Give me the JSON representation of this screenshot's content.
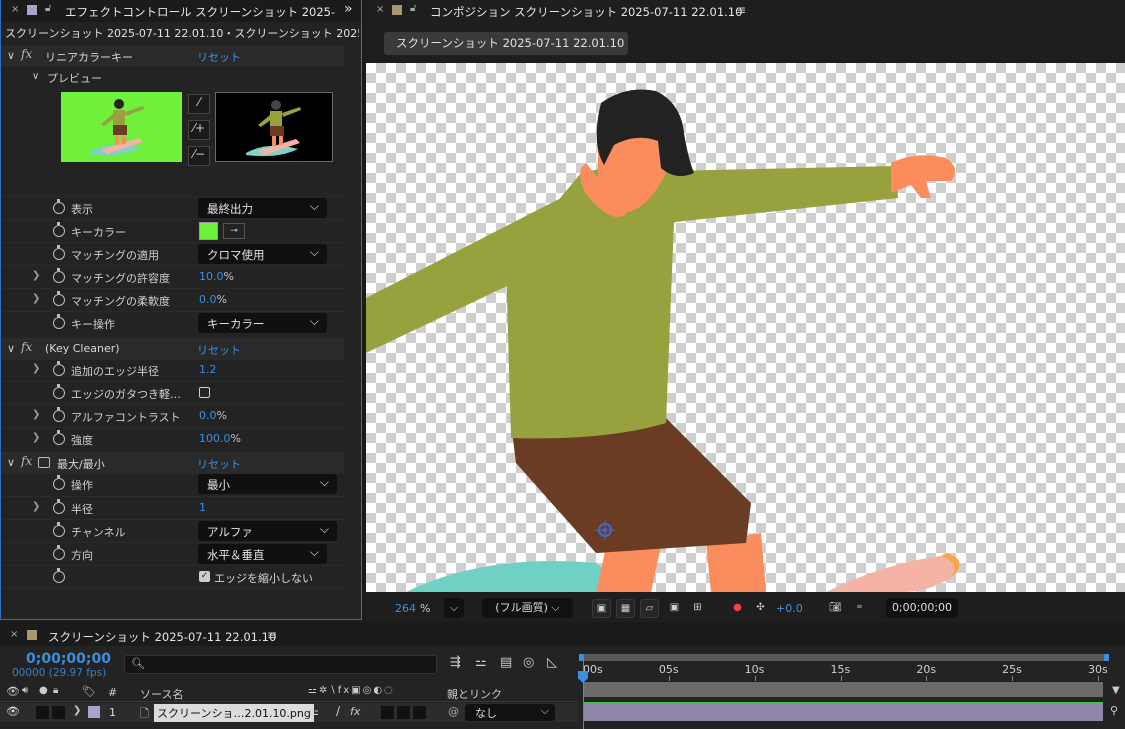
{
  "effect_panel": {
    "tab_title": "エフェクトコントロール スクリーンショット 2025-",
    "subtitle": "スクリーンショット 2025-07-11 22.01.10・スクリーンショット 2025-07-1",
    "overflow": "»",
    "reset_label": "リセット",
    "linear_key": {
      "name": "リニアカラーキー",
      "preview_label": "プレビュー",
      "props": {
        "display": {
          "label": "表示",
          "value": "最終出力"
        },
        "key_color": {
          "label": "キーカラー",
          "color": "#6ff03a"
        },
        "matching": {
          "label": "マッチングの適用",
          "value": "クロマ使用"
        },
        "tolerance": {
          "label": "マッチングの許容度",
          "value": "10.0",
          "unit": "%"
        },
        "softness": {
          "label": "マッチングの柔軟度",
          "value": "0.0",
          "unit": "%"
        },
        "key_op": {
          "label": "キー操作",
          "value": "キーカラー"
        }
      }
    },
    "key_cleaner": {
      "name": "(Key Cleaner)",
      "props": {
        "edge_radius": {
          "label": "追加のエッジ半径",
          "value": "1.2"
        },
        "edge_jag": {
          "label": "エッジのガタつき軽…"
        },
        "alpha_contrast": {
          "label": "アルファコントラスト",
          "value": "0.0",
          "unit": "%"
        },
        "strength": {
          "label": "強度",
          "value": "100.0",
          "unit": "%"
        }
      }
    },
    "minmax": {
      "name": "最大/最小",
      "props": {
        "operation": {
          "label": "操作",
          "value": "最小"
        },
        "radius": {
          "label": "半径",
          "value": "1"
        },
        "channel": {
          "label": "チャンネル",
          "value": "アルファ"
        },
        "direction": {
          "label": "方向",
          "value": "水平＆垂直"
        },
        "no_shrink": {
          "label": "エッジを縮小しない"
        }
      }
    }
  },
  "comp_panel": {
    "tab_title": "コンポジション スクリーンショット 2025-07-11 22.01.10",
    "comp_button": "スクリーンショット 2025-07-11 22.01.10",
    "zoom": "264",
    "zoom_unit": "%",
    "quality": "(フル画質)",
    "exposure": "+0.0",
    "timecode": "0;00;00;00"
  },
  "timeline": {
    "tab_title": "スクリーンショット 2025-07-11 22.01.10",
    "current_time": "0;00;00;00",
    "frames": "00000 (29.97 fps)",
    "col_source": "ソース名",
    "col_num": "#",
    "col_parent": "親とリンク",
    "ruler": [
      "00s",
      "05s",
      "10s",
      "15s",
      "20s",
      "25s",
      "30s"
    ],
    "layer": {
      "index": "1",
      "name": "スクリーンショ…2.01.10.png",
      "parent": "なし"
    }
  },
  "colors": {
    "accent": "#3c8fe0",
    "layer_bar": "#8f86a8",
    "track": "#6b6b6b"
  }
}
